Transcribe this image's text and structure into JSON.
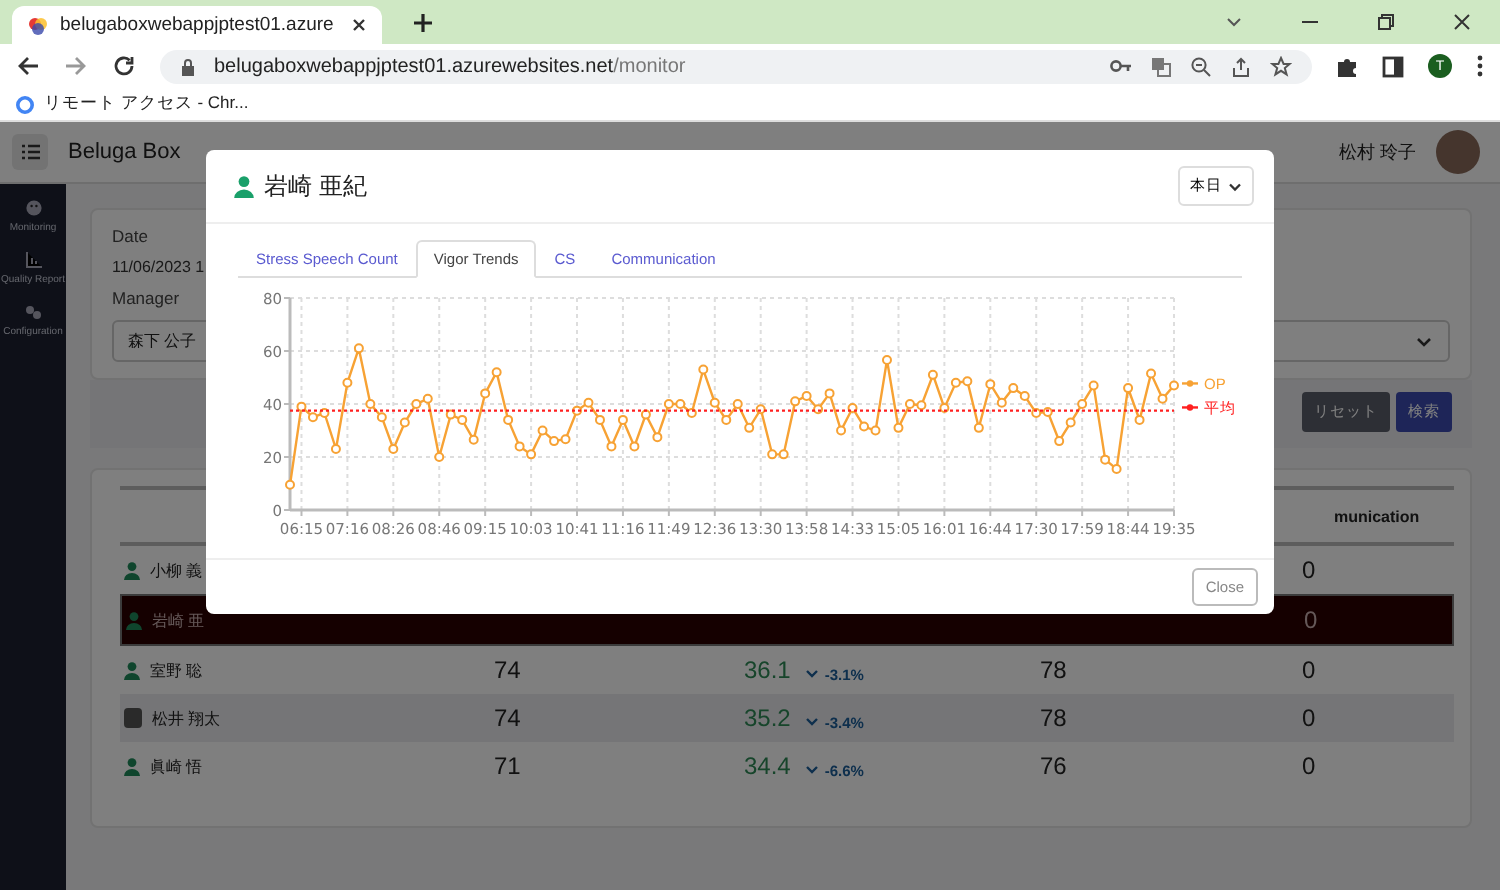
{
  "browser": {
    "tab_title": "belugaboxwebappjptest01.azure",
    "url_host": "belugaboxwebappjptest01.azurewebsites.net",
    "url_path": "/monitor",
    "bookmark": "リモート アクセス - Chr...",
    "profile_initial": "T"
  },
  "app": {
    "title": "Beluga Box",
    "user": "松村 玲子"
  },
  "sidebar": {
    "items": [
      {
        "label": "Monitoring",
        "kind": "face"
      },
      {
        "label": "Quality Report",
        "kind": "chart"
      },
      {
        "label": "Configuration",
        "kind": "gears"
      }
    ]
  },
  "filters": {
    "date_label": "Date",
    "date_value": "11/06/2023 1",
    "manager_label": "Manager",
    "manager_value": "森下 公子",
    "buttons": [
      {
        "label": "リセット",
        "kind": "secondary"
      },
      {
        "label": "検索",
        "kind": "primary"
      }
    ]
  },
  "table": {
    "columns": [
      "munication"
    ],
    "rows": [
      {
        "name": "小柳 義",
        "kind": "icon",
        "selected": false,
        "communication": "0"
      },
      {
        "name": "岩崎 亜",
        "kind": "icon",
        "selected": true,
        "communication": "0"
      },
      {
        "name": "室野 聡",
        "kind": "icon",
        "selected": false,
        "score": "74",
        "vigor": "36.1",
        "change": "-3.1%",
        "cs": "78",
        "communication": "0"
      },
      {
        "name": "松井 翔太",
        "kind": "photo",
        "selected": false,
        "score": "74",
        "vigor": "35.2",
        "change": "-3.4%",
        "cs": "78",
        "communication": "0"
      },
      {
        "name": "眞崎 悟",
        "kind": "icon",
        "selected": false,
        "score": "71",
        "vigor": "34.4",
        "change": "-6.6%",
        "cs": "76",
        "communication": "0"
      }
    ]
  },
  "modal": {
    "title": "岩崎 亜紀",
    "period": "本日",
    "tabs": [
      {
        "label": "Stress Speech Count",
        "selected": false
      },
      {
        "label": "Vigor Trends",
        "selected": true
      },
      {
        "label": "CS",
        "selected": false
      },
      {
        "label": "Communication",
        "selected": false
      }
    ],
    "chart_data": {
      "type": "line",
      "ylim": [
        0,
        80
      ],
      "yticks": [
        0,
        20,
        40,
        60,
        80
      ],
      "grid": true,
      "legend": true,
      "categories": [
        null,
        "06:15",
        null,
        null,
        null,
        "07:16",
        null,
        null,
        null,
        "08:26",
        null,
        null,
        null,
        "08:46",
        null,
        null,
        null,
        "09:15",
        null,
        null,
        null,
        "10:03",
        null,
        null,
        null,
        "10:41",
        null,
        null,
        null,
        "11:16",
        null,
        null,
        null,
        "11:49",
        null,
        null,
        null,
        "12:36",
        null,
        null,
        null,
        "13:30",
        null,
        null,
        null,
        "13:58",
        null,
        null,
        null,
        "14:33",
        null,
        null,
        null,
        "15:05",
        null,
        null,
        null,
        "16:01",
        null,
        null,
        null,
        "16:44",
        null,
        null,
        null,
        "17:30",
        null,
        null,
        null,
        "17:59",
        null,
        null,
        null,
        "18:44",
        null,
        null,
        null,
        "19:35"
      ],
      "series": [
        {
          "name": "OP",
          "color": "#f7a234",
          "marker": "circle",
          "values": [
            9.5,
            39,
            35,
            36.6,
            23,
            48,
            61,
            40,
            35,
            23,
            33,
            40,
            42,
            20,
            36,
            34,
            26.5,
            44,
            52,
            34,
            24,
            21,
            30,
            26,
            26.7,
            37.5,
            40.5,
            34,
            24,
            34,
            24,
            36,
            27.5,
            40,
            40,
            36.6,
            53,
            40.5,
            34,
            40,
            31,
            38,
            21,
            21,
            41,
            43,
            38,
            44,
            30,
            38.5,
            31.5,
            30,
            56.6,
            31,
            40,
            39.5,
            51,
            38.5,
            48,
            48.6,
            31,
            47.5,
            40.5,
            46,
            43,
            36.6,
            37,
            26,
            33,
            40,
            47,
            19,
            15.5,
            46,
            34,
            51.5,
            42,
            47
          ]
        },
        {
          "name": "平均",
          "color": "#ff2020",
          "line_style": "dashed",
          "values": [
            37.5,
            37.5,
            37.5,
            37.5,
            37.5,
            37.5,
            37.5,
            37.5,
            37.5,
            37.5,
            37.5,
            37.5,
            37.5,
            37.5,
            37.5,
            37.5,
            37.5,
            37.5,
            37.5,
            37.5,
            37.5,
            37.5,
            37.5,
            37.5,
            37.5,
            37.5,
            37.5,
            37.5,
            37.5,
            37.5,
            37.5,
            37.5,
            37.5,
            37.5,
            37.5,
            37.5,
            37.5,
            37.5,
            37.5,
            37.5,
            37.5,
            37.5,
            37.5,
            37.5,
            37.5,
            37.5,
            37.5,
            37.5,
            37.5,
            37.5,
            37.5,
            37.5,
            37.5,
            37.5,
            37.5,
            37.5,
            37.5,
            37.5,
            37.5,
            37.5,
            37.5,
            37.5,
            37.5,
            37.5,
            37.5,
            37.5,
            37.5,
            37.5,
            37.5,
            37.5,
            37.5,
            37.5,
            37.5,
            37.5,
            37.5,
            37.5,
            37.5,
            37.5
          ]
        }
      ]
    },
    "close": "Close"
  }
}
